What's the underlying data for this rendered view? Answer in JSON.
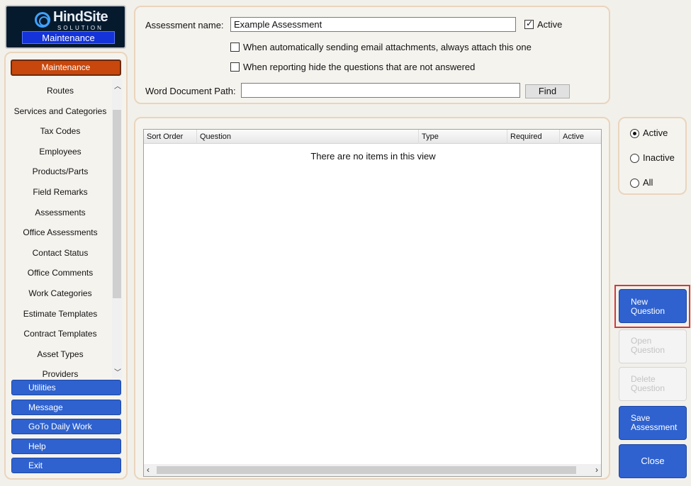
{
  "logo": {
    "name": "HindSite",
    "tagline": "SOLUTION",
    "badge": "Maintenance"
  },
  "sidebar": {
    "active_section": "Maintenance",
    "items": [
      "Routes",
      "Services and Categories",
      "Tax Codes",
      "Employees",
      "Products/Parts",
      "Field Remarks",
      "Assessments",
      "Office Assessments",
      "Contact Status",
      "Office Comments",
      "Work Categories",
      "Estimate Templates",
      "Contract Templates",
      "Asset Types",
      "Providers"
    ],
    "buttons": [
      "Utilities",
      "Message",
      "GoTo Daily Work",
      "Help",
      "Exit"
    ]
  },
  "form": {
    "name_label": "Assessment name:",
    "name_value": "Example Assessment",
    "active_label": "Active",
    "email_attach_label": "When automatically sending email attachments, always attach this one",
    "hide_unanswered_label": "When reporting hide the questions that are not answered",
    "word_path_label": "Word Document Path:",
    "word_path_value": "",
    "find_label": "Find"
  },
  "grid": {
    "columns": [
      "Sort Order",
      "Question",
      "Type",
      "Required",
      "Active"
    ],
    "empty_message": "There are no items in this view"
  },
  "filter": {
    "options": [
      "Active",
      "Inactive",
      "All"
    ],
    "selected": "Active"
  },
  "actions": {
    "new_question": [
      "New",
      "Question"
    ],
    "open_question": [
      "Open",
      "Question"
    ],
    "delete_question": [
      "Delete",
      "Question"
    ],
    "save_assessment": [
      "Save",
      "Assessment"
    ],
    "close": "Close"
  },
  "colors": {
    "accent_blue": "#2f62cf",
    "active_orange": "#c8470c",
    "highlight_red": "#d23a3a"
  }
}
